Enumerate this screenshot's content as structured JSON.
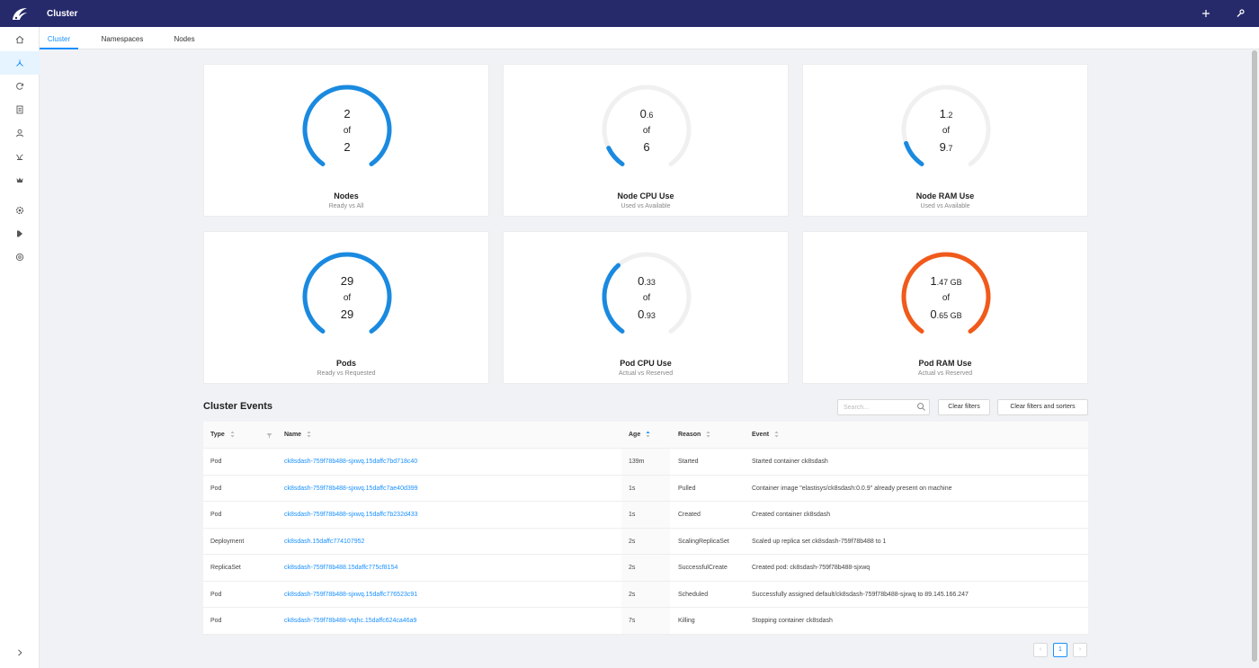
{
  "app": {
    "title": "Cluster"
  },
  "colors": {
    "topbar": "#262a6b",
    "accent": "#1890ff",
    "gauge_blue": "#1a8ae0",
    "gauge_orange": "#f05a1a",
    "gauge_track": "#f0f0f0"
  },
  "sidebar": {
    "items": [
      {
        "icon": "home-icon"
      },
      {
        "icon": "cluster-icon",
        "active": true
      },
      {
        "icon": "refresh-icon"
      },
      {
        "icon": "document-icon"
      },
      {
        "icon": "user-icon"
      },
      {
        "icon": "plant-icon"
      },
      {
        "icon": "crown-icon"
      },
      {
        "icon": "gear-icon"
      },
      {
        "icon": "k-icon"
      },
      {
        "icon": "globe-icon"
      }
    ],
    "expand_icon": "chevron-right-icon"
  },
  "tabs": [
    {
      "label": "Cluster",
      "active": true
    },
    {
      "label": "Namespaces"
    },
    {
      "label": "Nodes"
    }
  ],
  "cards": [
    {
      "big1": "2",
      "small1": "",
      "of": "of",
      "big2": "2",
      "small2": "",
      "title": "Nodes",
      "subtitle": "Ready vs All",
      "fraction": 1.0,
      "color": "blue"
    },
    {
      "big1": "0",
      "small1": ".6",
      "of": "of",
      "big2": "6",
      "small2": "",
      "title": "Node CPU Use",
      "subtitle": "Used vs Available",
      "fraction": 0.1,
      "color": "blue"
    },
    {
      "big1": "1",
      "small1": ".2",
      "of": "of",
      "big2": "9",
      "small2": ".7",
      "title": "Node RAM Use",
      "subtitle": "Used vs Available",
      "fraction": 0.124,
      "color": "blue"
    },
    {
      "big1": "29",
      "small1": "",
      "of": "of",
      "big2": "29",
      "small2": "",
      "title": "Pods",
      "subtitle": "Ready vs Requested",
      "fraction": 1.0,
      "color": "blue"
    },
    {
      "big1": "0",
      "small1": ".33",
      "of": "of",
      "big2": "0",
      "small2": ".93",
      "title": "Pod CPU Use",
      "subtitle": "Actual vs Reserved",
      "fraction": 0.355,
      "color": "blue"
    },
    {
      "big1": "1",
      "small1": ".47 GB",
      "of": "of",
      "big2": "0",
      "small2": ".65 GB",
      "title": "Pod RAM Use",
      "subtitle": "Actual vs Reserved",
      "fraction": 1.0,
      "color": "orange"
    }
  ],
  "events": {
    "title": "Cluster Events",
    "search_placeholder": "Search...",
    "clear_filters": "Clear filters",
    "clear_filters_sorters": "Clear filters and sorters",
    "columns": {
      "type": "Type",
      "name": "Name",
      "age": "Age",
      "reason": "Reason",
      "event": "Event"
    },
    "rows": [
      {
        "type": "Pod",
        "name": "ck8sdash-759f78b488-sjxwq.15daffc7bd718c40",
        "age": "139m",
        "reason": "Started",
        "event": "Started container ck8sdash"
      },
      {
        "type": "Pod",
        "name": "ck8sdash-759f78b488-sjxwq.15daffc7ae40d399",
        "age": "1s",
        "reason": "Pulled",
        "event": "Container image \"elastisys/ck8sdash:0.0.9\" already present on machine"
      },
      {
        "type": "Pod",
        "name": "ck8sdash-759f78b488-sjxwq.15daffc7b232d433",
        "age": "1s",
        "reason": "Created",
        "event": "Created container ck8sdash"
      },
      {
        "type": "Deployment",
        "name": "ck8sdash.15daffc774107952",
        "age": "2s",
        "reason": "ScalingReplicaSet",
        "event": "Scaled up replica set ck8sdash-759f78b488 to 1"
      },
      {
        "type": "ReplicaSet",
        "name": "ck8sdash-759f78b488.15daffc775cf8154",
        "age": "2s",
        "reason": "SuccessfulCreate",
        "event": "Created pod: ck8sdash-759f78b488-sjxwq"
      },
      {
        "type": "Pod",
        "name": "ck8sdash-759f78b488-sjxwq.15daffc776523c91",
        "age": "2s",
        "reason": "Scheduled",
        "event": "Successfully assigned default/ck8sdash-759f78b488-sjxwq to 89.145.166.247"
      },
      {
        "type": "Pod",
        "name": "ck8sdash-759f78b488-vtqhc.15daffc624ca46a9",
        "age": "7s",
        "reason": "Killing",
        "event": "Stopping container ck8sdash"
      }
    ]
  },
  "pagination": {
    "prev": "‹",
    "current": "1",
    "next": "›"
  }
}
